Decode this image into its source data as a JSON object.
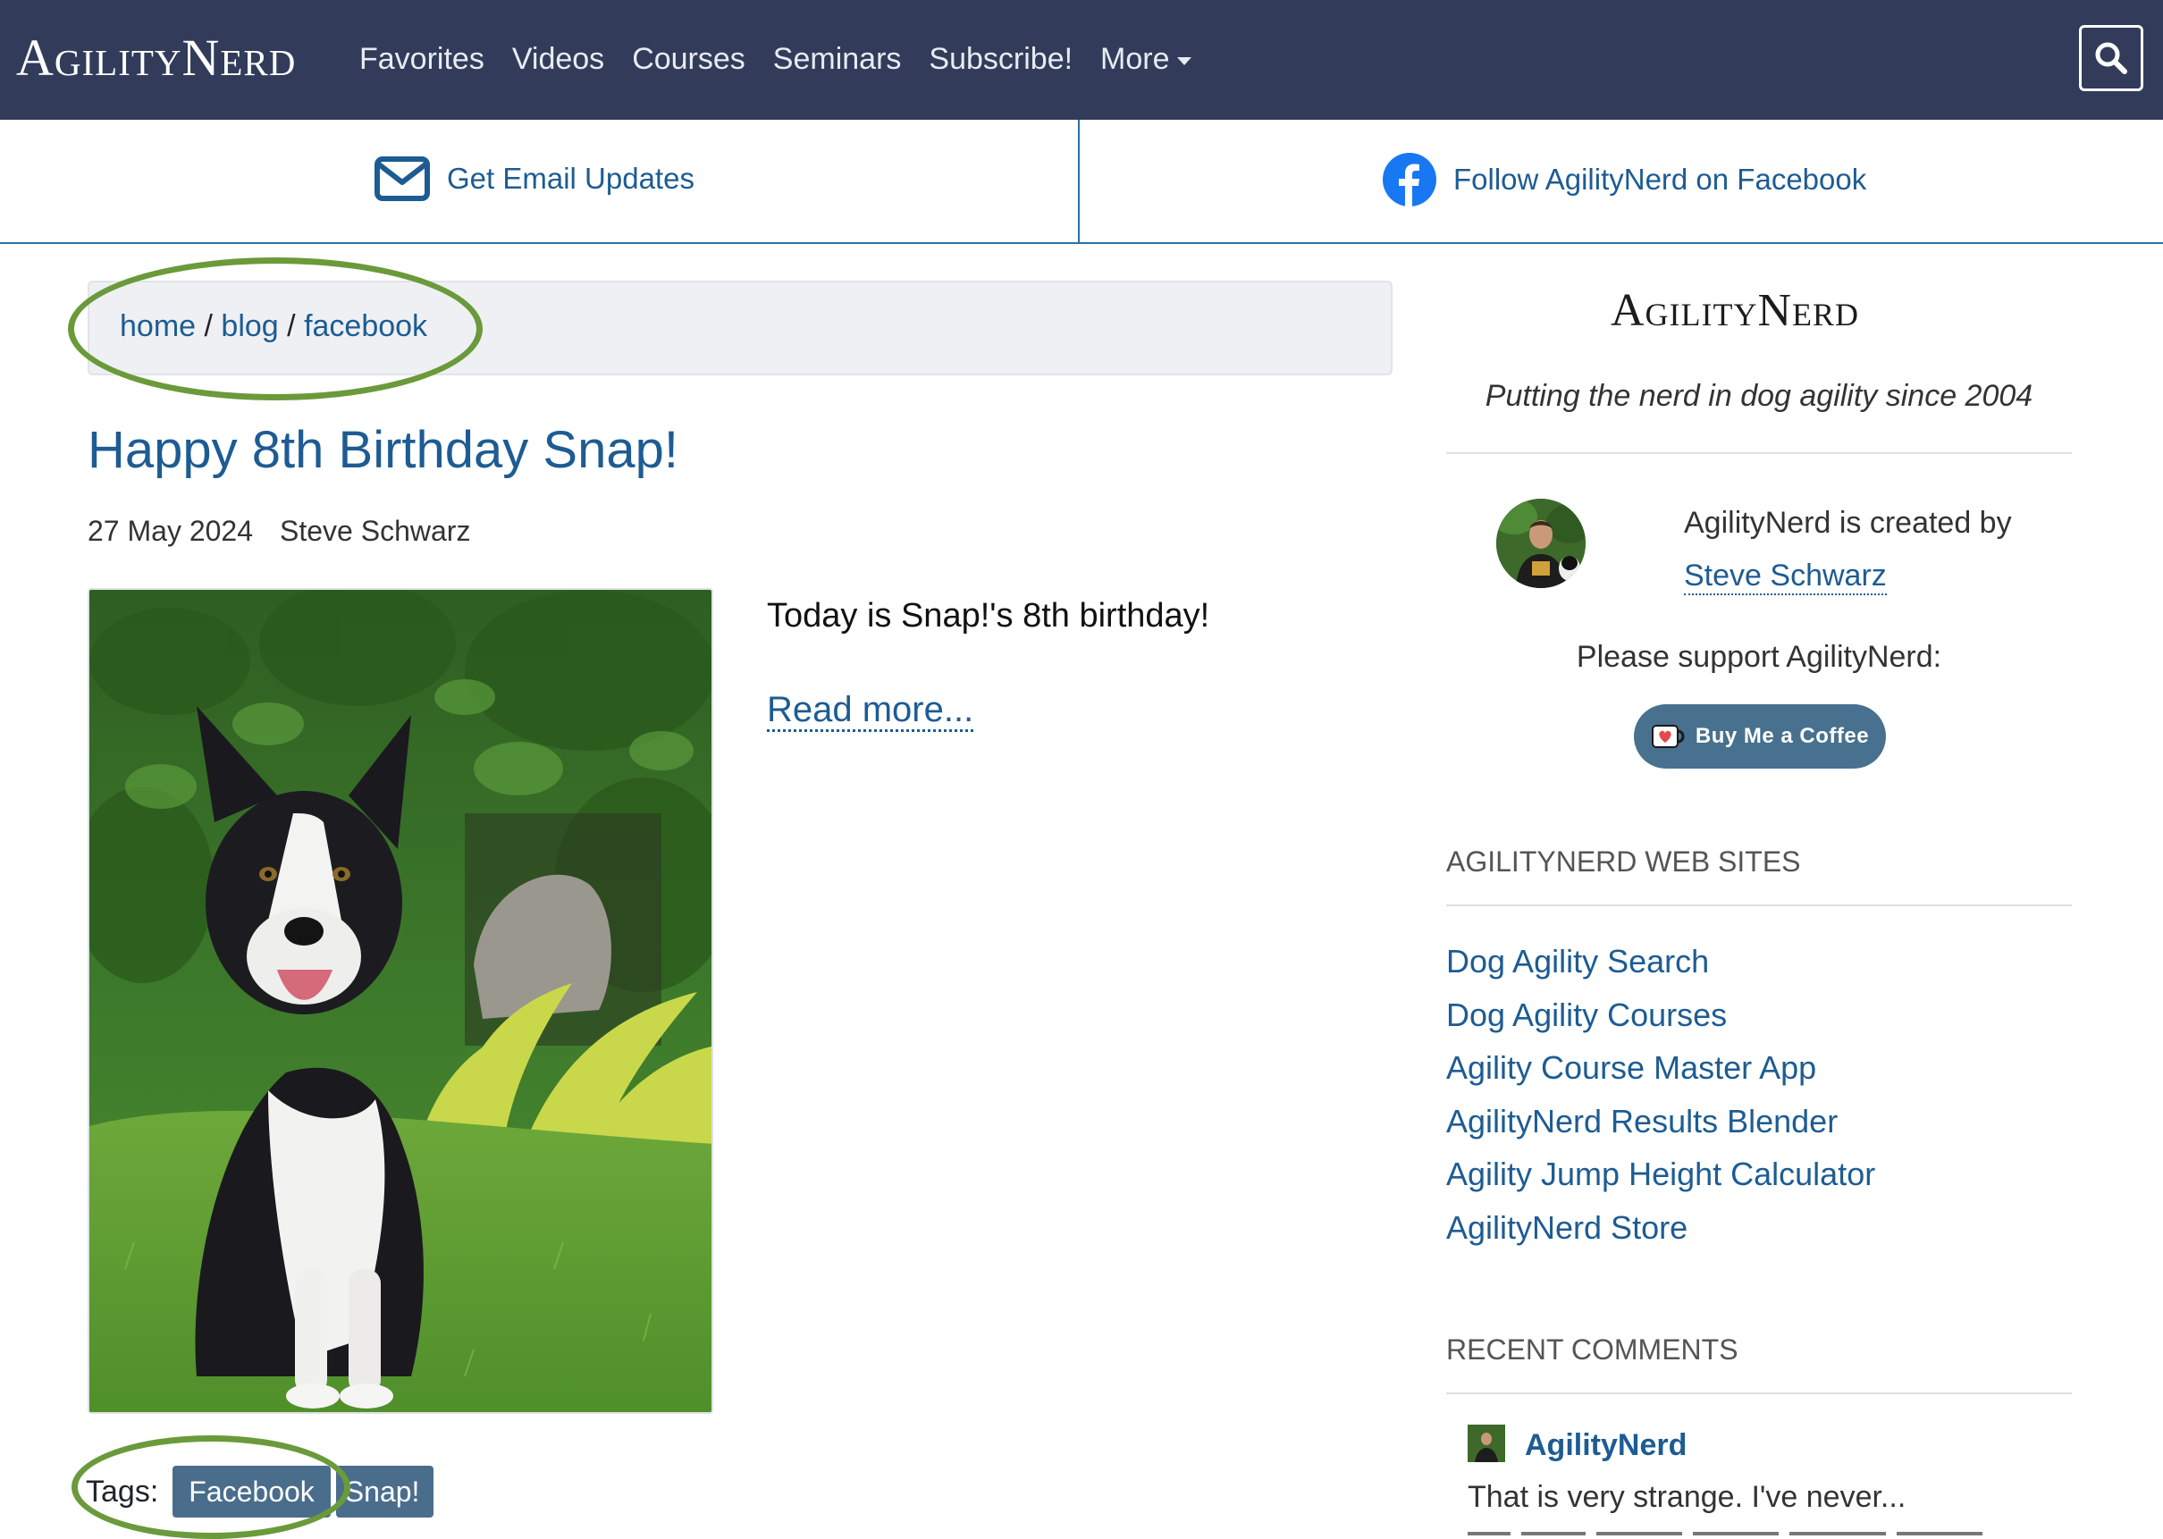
{
  "nav": {
    "logo": "AgilityNerd",
    "links": [
      "Favorites",
      "Videos",
      "Courses",
      "Seminars",
      "Subscribe!",
      "More"
    ]
  },
  "subscribe": {
    "email": "Get Email Updates",
    "facebook": "Follow AgilityNerd on Facebook"
  },
  "breadcrumb": {
    "home": "home",
    "blog": "blog",
    "current": "facebook",
    "separator": "/"
  },
  "post": {
    "title": "Happy 8th Birthday Snap!",
    "date": "27 May 2024",
    "author": "Steve Schwarz",
    "excerpt": "Today is Snap!'s 8th birthday!",
    "read_more": "Read more...",
    "tags_label": "Tags:",
    "tags": [
      "Facebook",
      "Snap!"
    ]
  },
  "sidebar": {
    "logo": "AgilityNerd",
    "tagline": "Putting the nerd in dog agility since 2004",
    "created_by": "AgilityNerd is created by",
    "creator": "Steve Schwarz",
    "support": "Please support AgilityNerd:",
    "coffee": "Buy Me a Coffee",
    "web_sites_heading": "AGILITYNERD WEB SITES",
    "web_sites": [
      "Dog Agility Search",
      "Dog Agility Courses",
      "Agility Course Master App",
      "AgilityNerd Results Blender",
      "Agility Jump Height Calculator",
      "AgilityNerd Store"
    ],
    "comments_heading": "RECENT COMMENTS",
    "comment": {
      "author": "AgilityNerd",
      "text": "That is very strange. I've never..."
    }
  },
  "colors": {
    "nav_bg": "#323c5a",
    "link": "#1d5c93",
    "highlight_oval": "#6a9a3a",
    "tag_bg": "#4a6d8c",
    "coffee_bg": "#47718e"
  },
  "icons": [
    "search-icon",
    "envelope-icon",
    "facebook-icon",
    "coffee-cup-icon",
    "caret-down-icon"
  ]
}
